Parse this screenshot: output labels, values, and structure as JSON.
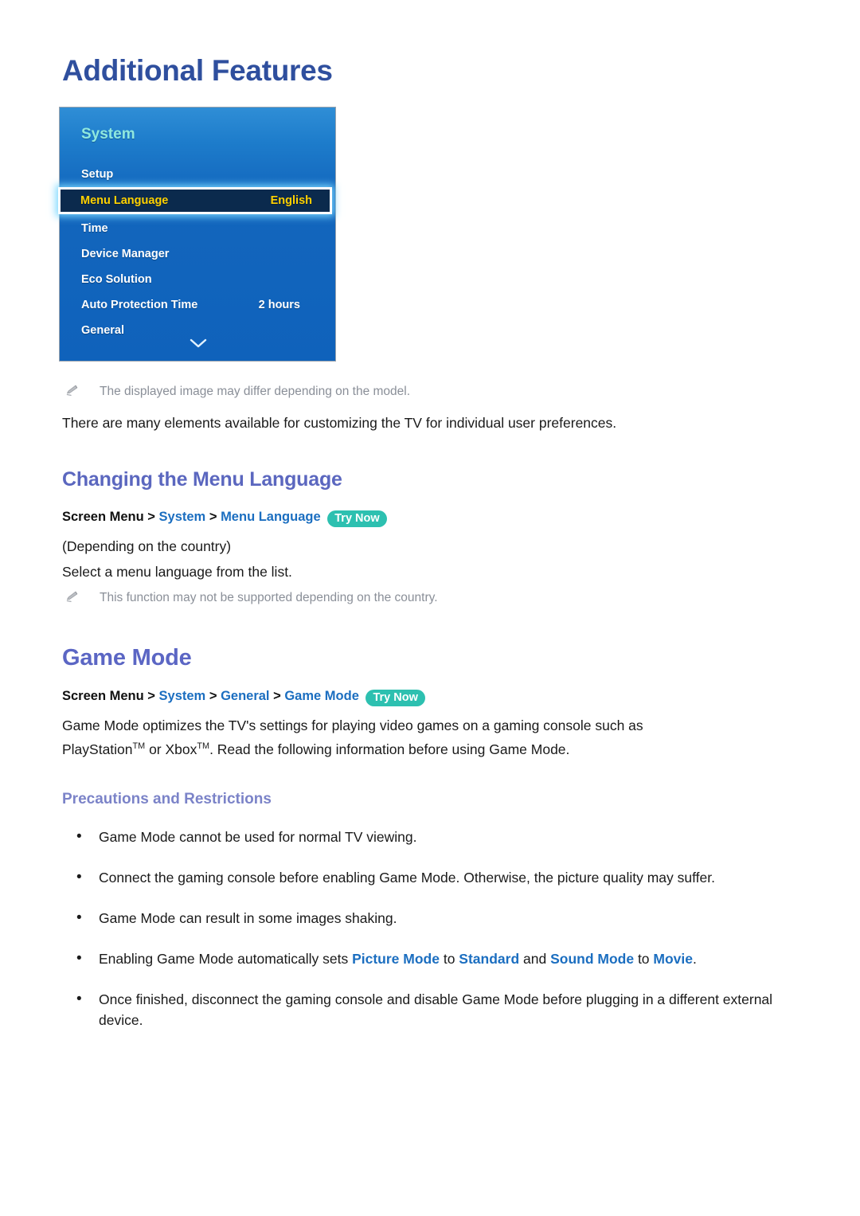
{
  "page": {
    "title": "Additional Features",
    "intro": "There are many elements available for customizing the TV for individual user preferences."
  },
  "tv_menu": {
    "title": "System",
    "scroll_icon": "chevron-down-icon",
    "rows": [
      {
        "label": "Setup",
        "value": "",
        "selected": false
      },
      {
        "label": "Menu Language",
        "value": "English",
        "selected": true
      },
      {
        "label": "Time",
        "value": "",
        "selected": false
      },
      {
        "label": "Device Manager",
        "value": "",
        "selected": false
      },
      {
        "label": "Eco Solution",
        "value": "",
        "selected": false
      },
      {
        "label": "Auto Protection Time",
        "value": "2 hours",
        "selected": false
      },
      {
        "label": "General",
        "value": "",
        "selected": false
      }
    ]
  },
  "notes": {
    "image_note": "The displayed image may differ depending on the model.",
    "country_note": "This function may not be supported depending on the country.",
    "icon": "pencil-icon"
  },
  "section_menu_language": {
    "heading": "Changing the Menu Language",
    "breadcrumb": {
      "root": "Screen Menu",
      "sep": ">",
      "level1": "System",
      "level2": "Menu Language",
      "badge": "Try Now"
    },
    "line1": "(Depending on the country)",
    "line2": "Select a menu language from the list."
  },
  "section_game_mode": {
    "heading": "Game Mode",
    "breadcrumb": {
      "root": "Screen Menu",
      "sep": ">",
      "level1": "System",
      "level2": "General",
      "level3": "Game Mode",
      "badge": "Try Now"
    },
    "body_line1": "Game Mode optimizes the TV's settings for playing video games on a gaming console such as",
    "body_line2_a": "PlayStation",
    "body_line2_tm1": "TM",
    "body_line2_b": " or Xbox",
    "body_line2_tm2": "TM",
    "body_line2_c": ". Read the following information before using Game Mode.",
    "subheading": "Precautions and Restrictions",
    "bullet_marker": "•",
    "bullets": [
      {
        "text": "Game Mode cannot be used for normal TV viewing."
      },
      {
        "text": "Connect the gaming console before enabling Game Mode. Otherwise, the picture quality may suffer."
      },
      {
        "text": "Game Mode can result in some images shaking."
      },
      {
        "rich": true,
        "pre": "Enabling Game Mode automatically sets ",
        "k1": "Picture Mode",
        "mid1": " to ",
        "k2": "Standard",
        "mid2": " and ",
        "k3": "Sound Mode",
        "mid3": " to ",
        "k4": "Movie",
        "post": "."
      },
      {
        "text": "Once finished, disconnect the gaming console and disable Game Mode before plugging in a different external device."
      }
    ]
  },
  "colors": {
    "title_blue": "#2f4f9e",
    "heading_purple": "#5b66c4",
    "subheading_purple": "#7b83c8",
    "link_blue": "#1b6ec0",
    "badge_teal": "#2dc0b0",
    "menu_blue": "#1366bd",
    "menu_selected_bg": "#0b2a4d",
    "menu_selected_text": "#ffd100",
    "menu_title_cyan": "#8fe8df",
    "note_gray": "#8a8f98"
  }
}
